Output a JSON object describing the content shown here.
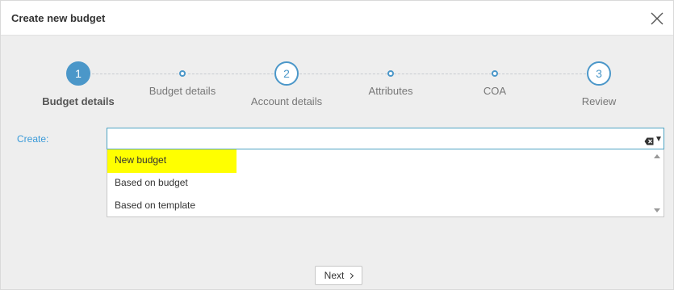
{
  "dialog": {
    "title": "Create new budget",
    "close_icon": "close-icon"
  },
  "stepper": {
    "steps": [
      {
        "kind": "numbered",
        "number": "1",
        "label": "Budget details",
        "active": true
      },
      {
        "kind": "substep",
        "label": "Budget details"
      },
      {
        "kind": "numbered",
        "number": "2",
        "label": "Account details"
      },
      {
        "kind": "substep",
        "label": "Attributes"
      },
      {
        "kind": "substep",
        "label": "COA"
      },
      {
        "kind": "numbered",
        "number": "3",
        "label": "Review"
      }
    ]
  },
  "form": {
    "create_label": "Create:",
    "create_value": "",
    "clear_icon": "clear-input-icon",
    "dropdown_icon": "chevron-down-icon",
    "options": [
      "New budget",
      "Based on budget",
      "Based on template"
    ],
    "highlighted_option": "New budget"
  },
  "footer": {
    "next_label": "Next",
    "next_icon": "chevron-right-icon"
  },
  "colors": {
    "accent": "#4b97c9",
    "highlight": "#ffff00",
    "label": "#3a9ad9"
  }
}
